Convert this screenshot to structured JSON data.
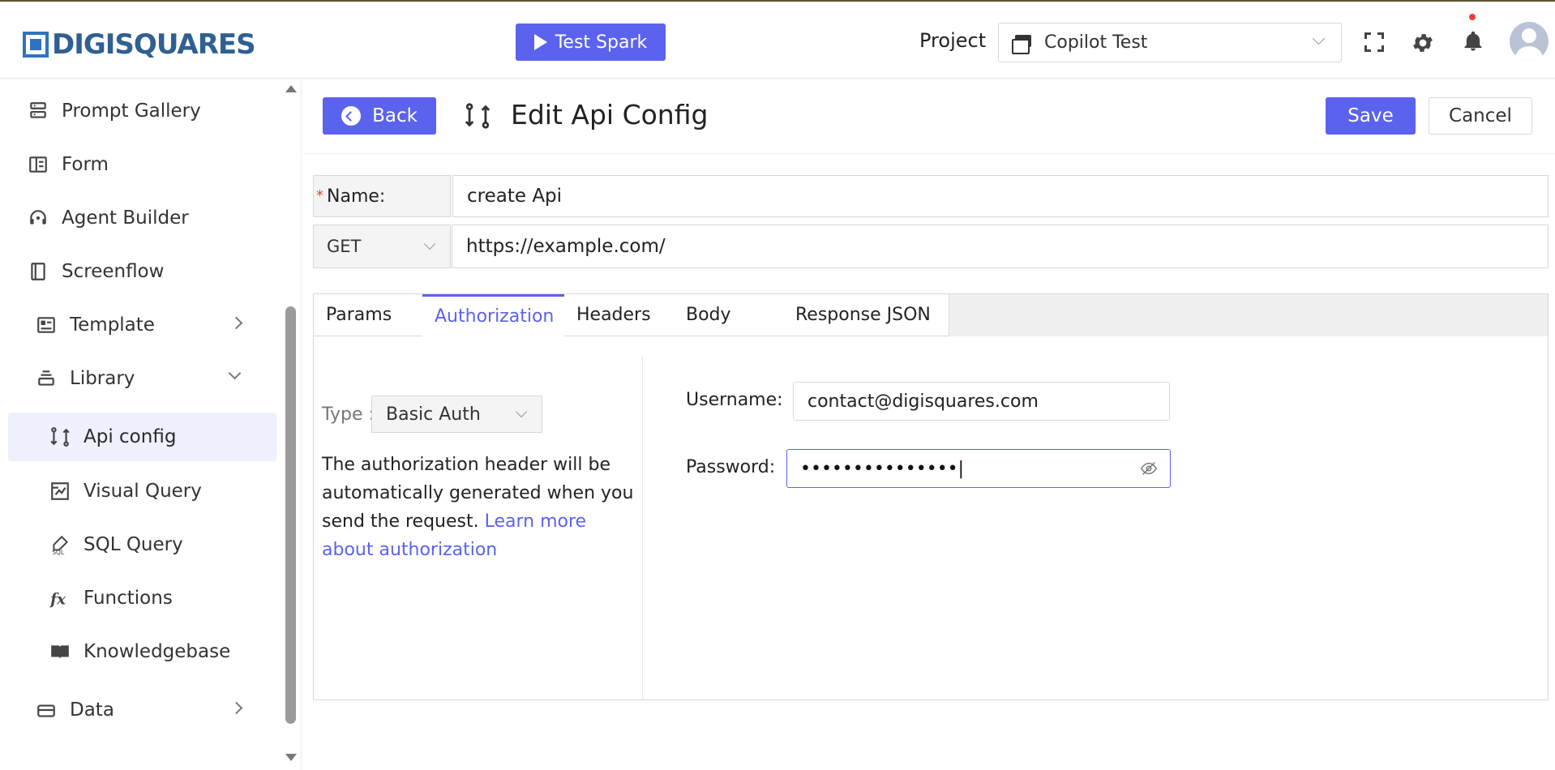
{
  "brand": {
    "logo_text": "DIGISQUARES",
    "accent_color": "#5b63ee",
    "logo_color": "#2f73c0"
  },
  "topbar": {
    "test_spark_label": "Test Spark",
    "project_label": "Project",
    "project_value": "Copilot Test",
    "icons": [
      "fullscreen-icon",
      "gear-icon",
      "bell-icon",
      "avatar"
    ]
  },
  "sidebar": {
    "items": [
      {
        "label": "Prompt Gallery",
        "icon": "gallery-icon"
      },
      {
        "label": "Form",
        "icon": "form-icon"
      },
      {
        "label": "Agent Builder",
        "icon": "headset-icon"
      },
      {
        "label": "Screenflow",
        "icon": "book-icon"
      },
      {
        "label": "Template",
        "icon": "template-icon",
        "expandable": true
      },
      {
        "label": "Library",
        "icon": "stack-icon",
        "expanded": true
      },
      {
        "label": "Api config",
        "icon": "api-icon",
        "active": true
      },
      {
        "label": "Visual Query",
        "icon": "visual-query-icon"
      },
      {
        "label": "SQL Query",
        "icon": "sql-icon"
      },
      {
        "label": "Functions",
        "icon": "fx-icon"
      },
      {
        "label": "Knowledgebase",
        "icon": "open-book-icon"
      },
      {
        "label": "Data",
        "icon": "drive-icon",
        "expandable": true
      }
    ]
  },
  "header": {
    "back_label": "Back",
    "title": "Edit Api Config",
    "save_label": "Save",
    "cancel_label": "Cancel"
  },
  "form": {
    "name_label": "Name:",
    "required_mark": "*",
    "name_value": "create Api",
    "method_value": "GET",
    "url_value": "https://example.com/"
  },
  "tabs": [
    {
      "label": "Params"
    },
    {
      "label": "Authorization",
      "active": true
    },
    {
      "label": "Headers"
    },
    {
      "label": "Body"
    },
    {
      "label": "Response JSON"
    }
  ],
  "auth": {
    "type_label": "Type :",
    "type_value": "Basic Auth",
    "description": "The authorization header will be automatically generated when you send the request.",
    "link_text": "Learn more about authorization",
    "username_label": "Username:",
    "username_value": "contact@digisquares.com",
    "password_label": "Password:",
    "password_value": "•••••••••••••••|"
  }
}
